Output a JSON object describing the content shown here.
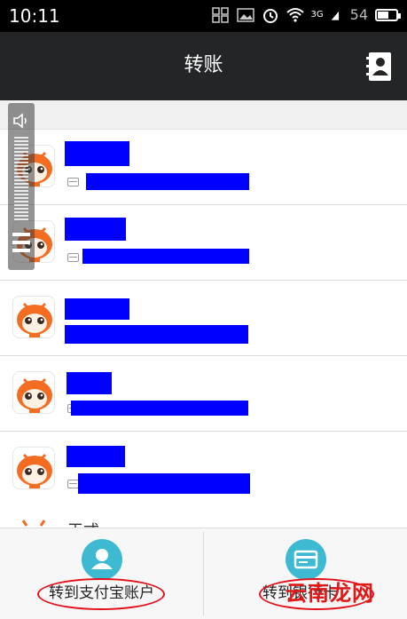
{
  "status_bar": {
    "time": "10:11",
    "signal_label": "3G",
    "battery_level": "54"
  },
  "header": {
    "title": "转账"
  },
  "contacts": [
    {
      "has_card_icon": true
    },
    {
      "has_card_icon": true
    },
    {
      "has_card_icon": false
    },
    {
      "has_card_icon": true
    },
    {
      "has_card_icon": true
    }
  ],
  "peek_row": {
    "text": "王式"
  },
  "bottom_actions": [
    {
      "label": "转到支付宝账户",
      "icon": "user-icon"
    },
    {
      "label": "转到银行卡",
      "icon": "bank-card-icon"
    }
  ],
  "watermark": {
    "text": "云南龙网"
  },
  "colors": {
    "accent": "#3dbad1",
    "header_bg": "#232527",
    "redaction": "#0000ff",
    "annotation": "#e3101a"
  }
}
